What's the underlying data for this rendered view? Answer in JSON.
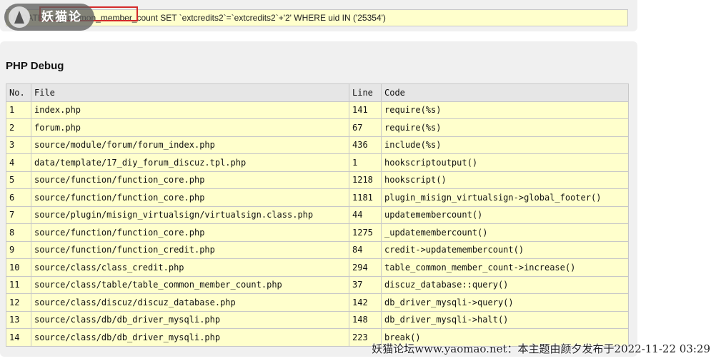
{
  "sql": {
    "query": "UPDATE pre_common_member_count SET `extcredits2`=`extcredits2`+'2' WHERE uid IN ('25354')"
  },
  "logo": {
    "text": "妖猫论坛"
  },
  "debug": {
    "title": "PHP Debug",
    "columns": [
      "No.",
      "File",
      "Line",
      "Code"
    ],
    "rows": [
      {
        "no": "1",
        "file": "index.php",
        "line": "141",
        "code": "require(%s)"
      },
      {
        "no": "2",
        "file": "forum.php",
        "line": "67",
        "code": "require(%s)"
      },
      {
        "no": "3",
        "file": "source/module/forum/forum_index.php",
        "line": "436",
        "code": "include(%s)"
      },
      {
        "no": "4",
        "file": "data/template/17_diy_forum_discuz.tpl.php",
        "line": "1",
        "code": "hookscriptoutput()"
      },
      {
        "no": "5",
        "file": "source/function/function_core.php",
        "line": "1218",
        "code": "hookscript()"
      },
      {
        "no": "6",
        "file": "source/function/function_core.php",
        "line": "1181",
        "code": "plugin_misign_virtualsign->global_footer()"
      },
      {
        "no": "7",
        "file": "source/plugin/misign_virtualsign/virtualsign.class.php",
        "line": "44",
        "code": "updatemembercount()"
      },
      {
        "no": "8",
        "file": "source/function/function_core.php",
        "line": "1275",
        "code": "_updatemembercount()"
      },
      {
        "no": "9",
        "file": "source/function/function_credit.php",
        "line": "84",
        "code": "credit->updatemembercount()"
      },
      {
        "no": "10",
        "file": "source/class/class_credit.php",
        "line": "294",
        "code": "table_common_member_count->increase()"
      },
      {
        "no": "11",
        "file": "source/class/table/table_common_member_count.php",
        "line": "37",
        "code": "discuz_database::query()"
      },
      {
        "no": "12",
        "file": "source/class/discuz/discuz_database.php",
        "line": "142",
        "code": "db_driver_mysqli->query()"
      },
      {
        "no": "13",
        "file": "source/class/db/db_driver_mysqli.php",
        "line": "148",
        "code": "db_driver_mysqli->halt()"
      },
      {
        "no": "14",
        "file": "source/class/db/db_driver_mysqli.php",
        "line": "223",
        "code": "break()"
      }
    ]
  },
  "watermark": {
    "text": "妖猫论坛www.yaomao.net：本主题由颜夕发布于2022-11-22 03:29"
  },
  "colors": {
    "row_background": "#ffffcc",
    "header_background": "#e6e6e6",
    "highlight_border": "#d42a2a"
  }
}
